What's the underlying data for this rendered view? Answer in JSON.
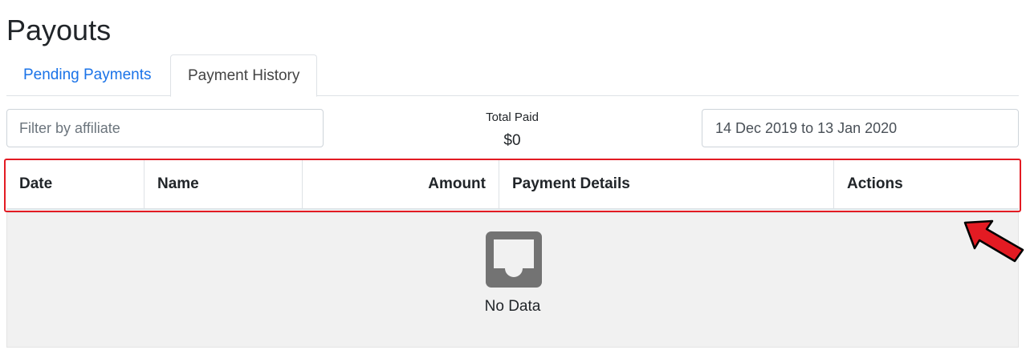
{
  "page": {
    "title": "Payouts"
  },
  "tabs": [
    {
      "label": "Pending Payments"
    },
    {
      "label": "Payment History"
    }
  ],
  "filter": {
    "placeholder": "Filter by affiliate",
    "value": ""
  },
  "summary": {
    "label": "Total Paid",
    "value": "$0"
  },
  "date_range": {
    "value": "14 Dec 2019 to 13 Jan 2020"
  },
  "table": {
    "columns": [
      "Date",
      "Name",
      "Amount",
      "Payment Details",
      "Actions"
    ],
    "rows": []
  },
  "empty_state": {
    "text": "No Data",
    "icon": "inbox-icon"
  },
  "annotations": {
    "highlight_color": "#e31b23",
    "arrow_color": "#e31b23"
  },
  "colors": {
    "link": "#1a73e8",
    "empty_bg": "#f1f1f1",
    "icon": "#737373"
  }
}
